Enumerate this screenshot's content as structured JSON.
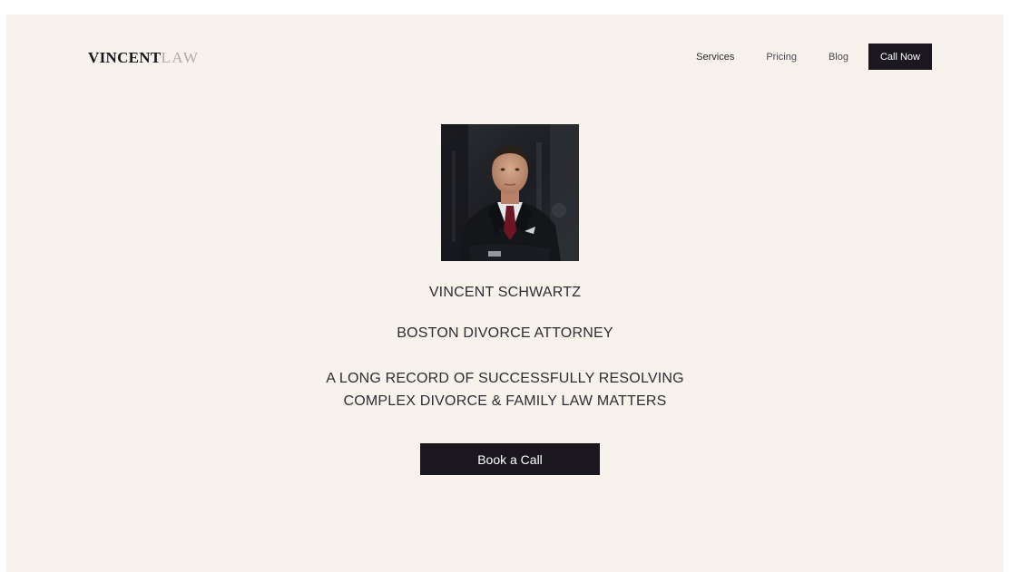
{
  "brand": {
    "strong": "VINCENT",
    "light": "LAW"
  },
  "nav": {
    "items": [
      {
        "label": "Services"
      },
      {
        "label": "Pricing"
      },
      {
        "label": "Blog"
      }
    ],
    "cta_label": "Call Now"
  },
  "hero": {
    "portrait_icon": "attorney-portrait-photo",
    "name": "VINCENT SCHWARTZ",
    "title": "BOSTON DIVORCE ATTORNEY",
    "tagline_line1": "A LONG RECORD OF SUCCESSFULLY RESOLVING",
    "tagline_line2": "COMPLEX DIVORCE & FAMILY LAW MATTERS",
    "cta_label": "Book a Call"
  },
  "colors": {
    "background": "#f7f2ec",
    "dark": "#1a181e",
    "logo_light": "#b4aaa2",
    "text": "#2e2d33"
  }
}
